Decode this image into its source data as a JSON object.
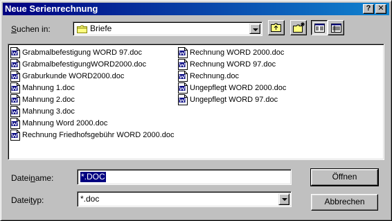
{
  "window": {
    "title": "Neue Serienrechnung",
    "help_label": "?",
    "close_label": "✕"
  },
  "look_in": {
    "label_prefix": "",
    "label_accel": "S",
    "label_rest": "uchen in:",
    "value": "Briefe",
    "icon": "folder-icon"
  },
  "toolbar": {
    "up_icon": "folder-up-icon",
    "new_folder_icon": "new-folder-icon",
    "list_view_icon": "list-view-icon",
    "details_view_icon": "details-view-icon"
  },
  "files": {
    "column1": [
      "Grabmalbefestigung WORD 97.doc",
      "GrabmalbefestigungWORD2000.doc",
      "Graburkunde WORD2000.doc",
      "Mahnung 1.doc",
      "Mahnung 2.doc",
      "Mahnung 3.doc",
      "Mahnung Word 2000.doc",
      "Rechnung Friedhofsgebühr WORD 2000.doc"
    ],
    "column2": [
      "Rechnung WORD 2000.doc",
      "Rechnung WORD 97.doc",
      "Rechnung.doc",
      "Ungepflegt WORD 2000.doc",
      "Ungepflegt WORD 97.doc"
    ],
    "icon": "word-document-icon"
  },
  "filename": {
    "label_prefix": "Datei",
    "label_accel": "n",
    "label_rest": "ame:",
    "value": "*.DOC"
  },
  "filetype": {
    "label_prefix": "Datei",
    "label_accel": "t",
    "label_rest": "yp:",
    "value": "*.doc"
  },
  "buttons": {
    "open": "Öffnen",
    "cancel": "Abbrechen"
  },
  "colors": {
    "title_start": "#000080",
    "title_end": "#1084d0",
    "selection": "#000080",
    "face": "#c0c0c0"
  }
}
